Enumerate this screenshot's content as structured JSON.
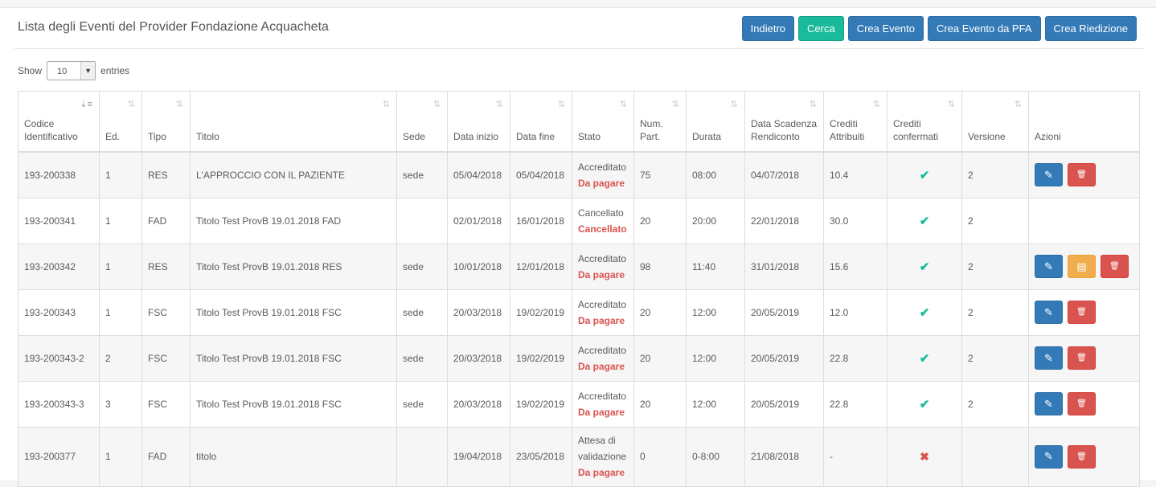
{
  "header": {
    "title": "Lista degli Eventi del Provider Fondazione Acquacheta"
  },
  "toolbar": {
    "back_label": "Indietro",
    "search_label": "Cerca",
    "create_label": "Crea Evento",
    "create_pfa_label": "Crea Evento da PFA",
    "reedition_label": "Crea Riedizione"
  },
  "length_menu": {
    "show_label": "Show",
    "value": "10",
    "entries_label": "entries"
  },
  "columns": [
    "Codice Identificativo",
    "Ed.",
    "Tipo",
    "Titolo",
    "Sede",
    "Data inizio",
    "Data fine",
    "Stato",
    "Num. Part.",
    "Durata",
    "Data Scadenza Rendiconto",
    "Crediti Attribuiti",
    "Crediti confermati",
    "Versione",
    "Azioni"
  ],
  "rows": [
    {
      "codice": "193-200338",
      "ed": "1",
      "tipo": "RES",
      "titolo": "L'APPROCCIO CON IL PAZIENTE",
      "sede": "sede",
      "inizio": "05/04/2018",
      "fine": "05/04/2018",
      "stato1": "Accreditato",
      "stato2": "Da pagare",
      "part": "75",
      "durata": "08:00",
      "scadenza": "04/07/2018",
      "crediti": "10.4",
      "confermati": "check-icon",
      "versione": "2",
      "actions": [
        "edit",
        "delete"
      ]
    },
    {
      "codice": "193-200341",
      "ed": "1",
      "tipo": "FAD",
      "titolo": "Titolo Test ProvB 19.01.2018 FAD",
      "sede": "",
      "inizio": "02/01/2018",
      "fine": "16/01/2018",
      "stato1": "Cancellato",
      "stato2": "Cancellato",
      "part": "20",
      "durata": "20:00",
      "scadenza": "22/01/2018",
      "crediti": "30.0",
      "confermati": "check-icon",
      "versione": "2",
      "actions": []
    },
    {
      "codice": "193-200342",
      "ed": "1",
      "tipo": "RES",
      "titolo": "Titolo Test ProvB 19.01.2018 RES",
      "sede": "sede",
      "inizio": "10/01/2018",
      "fine": "12/01/2018",
      "stato1": "Accreditato",
      "stato2": "Da pagare",
      "part": "98",
      "durata": "11:40",
      "scadenza": "31/01/2018",
      "crediti": "15.6",
      "confermati": "check-icon",
      "versione": "2",
      "actions": [
        "edit",
        "document",
        "delete"
      ]
    },
    {
      "codice": "193-200343",
      "ed": "1",
      "tipo": "FSC",
      "titolo": "Titolo Test ProvB 19.01.2018 FSC",
      "sede": "sede",
      "inizio": "20/03/2018",
      "fine": "19/02/2019",
      "stato1": "Accreditato",
      "stato2": "Da pagare",
      "part": "20",
      "durata": "12:00",
      "scadenza": "20/05/2019",
      "crediti": "12.0",
      "confermati": "check-icon",
      "versione": "2",
      "actions": [
        "edit",
        "delete"
      ]
    },
    {
      "codice": "193-200343-2",
      "ed": "2",
      "tipo": "FSC",
      "titolo": "Titolo Test ProvB 19.01.2018 FSC",
      "sede": "sede",
      "inizio": "20/03/2018",
      "fine": "19/02/2019",
      "stato1": "Accreditato",
      "stato2": "Da pagare",
      "part": "20",
      "durata": "12:00",
      "scadenza": "20/05/2019",
      "crediti": "22.8",
      "confermati": "check-icon",
      "versione": "2",
      "actions": [
        "edit",
        "delete"
      ]
    },
    {
      "codice": "193-200343-3",
      "ed": "3",
      "tipo": "FSC",
      "titolo": "Titolo Test ProvB 19.01.2018 FSC",
      "sede": "sede",
      "inizio": "20/03/2018",
      "fine": "19/02/2019",
      "stato1": "Accreditato",
      "stato2": "Da pagare",
      "part": "20",
      "durata": "12:00",
      "scadenza": "20/05/2019",
      "crediti": "22.8",
      "confermati": "check-icon",
      "versione": "2",
      "actions": [
        "edit",
        "delete"
      ]
    },
    {
      "codice": "193-200377",
      "ed": "1",
      "tipo": "FAD",
      "titolo": "titolo",
      "sede": "",
      "inizio": "19/04/2018",
      "fine": "23/05/2018",
      "stato1": "Attesa di validazione",
      "stato2": "Da pagare",
      "part": "0",
      "durata": "0-8:00",
      "scadenza": "21/08/2018",
      "crediti": "-",
      "confermati": "cross-icon",
      "versione": "",
      "actions": [
        "edit",
        "delete"
      ]
    }
  ]
}
